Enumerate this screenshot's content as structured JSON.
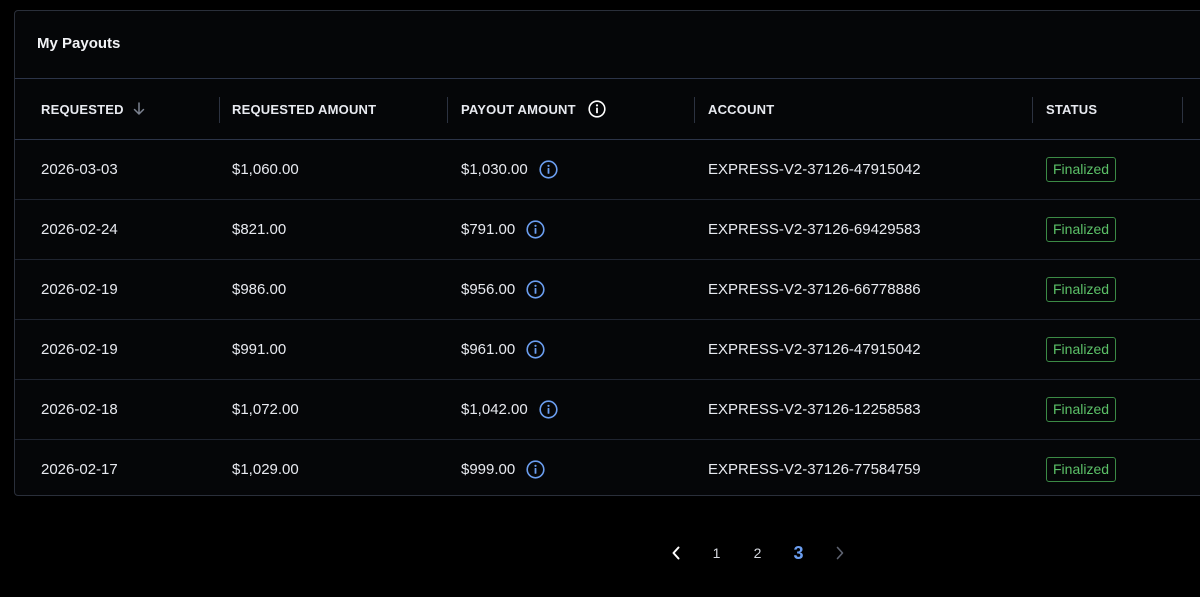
{
  "card": {
    "title": "My Payouts"
  },
  "table": {
    "headers": {
      "requested": "REQUESTED",
      "requested_amount": "REQUESTED AMOUNT",
      "payout_amount": "PAYOUT AMOUNT",
      "account": "ACCOUNT",
      "status": "STATUS"
    },
    "sort": {
      "column": "requested",
      "direction": "descending",
      "icon": "arrow-down-icon"
    },
    "rows": [
      {
        "requested": "2026-03-03",
        "requested_amount": "$1,060.00",
        "payout_amount": "$1,030.00",
        "account": "EXPRESS-V2-37126-47915042",
        "status": "Finalized"
      },
      {
        "requested": "2026-02-24",
        "requested_amount": "$821.00",
        "payout_amount": "$791.00",
        "account": "EXPRESS-V2-37126-69429583",
        "status": "Finalized"
      },
      {
        "requested": "2026-02-19",
        "requested_amount": "$986.00",
        "payout_amount": "$956.00",
        "account": "EXPRESS-V2-37126-66778886",
        "status": "Finalized"
      },
      {
        "requested": "2026-02-19",
        "requested_amount": "$991.00",
        "payout_amount": "$961.00",
        "account": "EXPRESS-V2-37126-47915042",
        "status": "Finalized"
      },
      {
        "requested": "2026-02-18",
        "requested_amount": "$1,072.00",
        "payout_amount": "$1,042.00",
        "account": "EXPRESS-V2-37126-12258583",
        "status": "Finalized"
      },
      {
        "requested": "2026-02-17",
        "requested_amount": "$1,029.00",
        "payout_amount": "$999.00",
        "account": "EXPRESS-V2-37126-77584759",
        "status": "Finalized"
      }
    ]
  },
  "pagination": {
    "pages": [
      "1",
      "2",
      "3"
    ],
    "current": "3",
    "prev_icon": "chevron-left-icon",
    "next_icon": "chevron-right-icon"
  },
  "colors": {
    "background": "#000000",
    "border": "#2c3448",
    "status_finalized": "#5cc168",
    "info_icon": "#6b9ef0",
    "active_page": "#6b9ef0"
  }
}
